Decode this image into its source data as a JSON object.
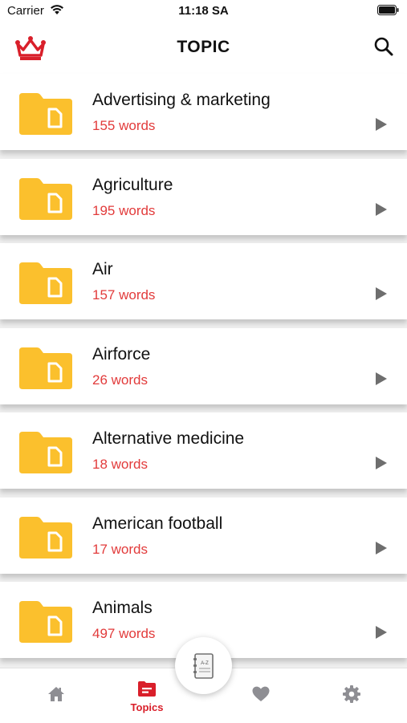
{
  "status_bar": {
    "carrier": "Carrier",
    "time": "11:18 SA"
  },
  "nav": {
    "title": "TOPIC",
    "left_icon": "crown-icon",
    "right_icon": "search-icon"
  },
  "topics": [
    {
      "name": "Advertising & marketing",
      "count": "155 words"
    },
    {
      "name": "Agriculture",
      "count": "195 words"
    },
    {
      "name": "Air",
      "count": "157 words"
    },
    {
      "name": "Airforce",
      "count": "26 words"
    },
    {
      "name": "Alternative medicine",
      "count": "18 words"
    },
    {
      "name": "American football",
      "count": "17 words"
    },
    {
      "name": "Animals",
      "count": "497 words"
    }
  ],
  "tab_bar": {
    "tabs": [
      {
        "icon": "home-icon",
        "label": ""
      },
      {
        "icon": "topics-icon",
        "label": "Topics",
        "active": true
      },
      {
        "icon": "heart-icon",
        "label": ""
      },
      {
        "icon": "gear-icon",
        "label": ""
      }
    ],
    "center_icon": "dictionary-icon",
    "center_icon_text": "A-Z"
  },
  "colors": {
    "accent": "#d91f2a",
    "word_count": "#e23b3b",
    "folder": "#fbc02d",
    "inactive_icon": "#8e8e93"
  }
}
